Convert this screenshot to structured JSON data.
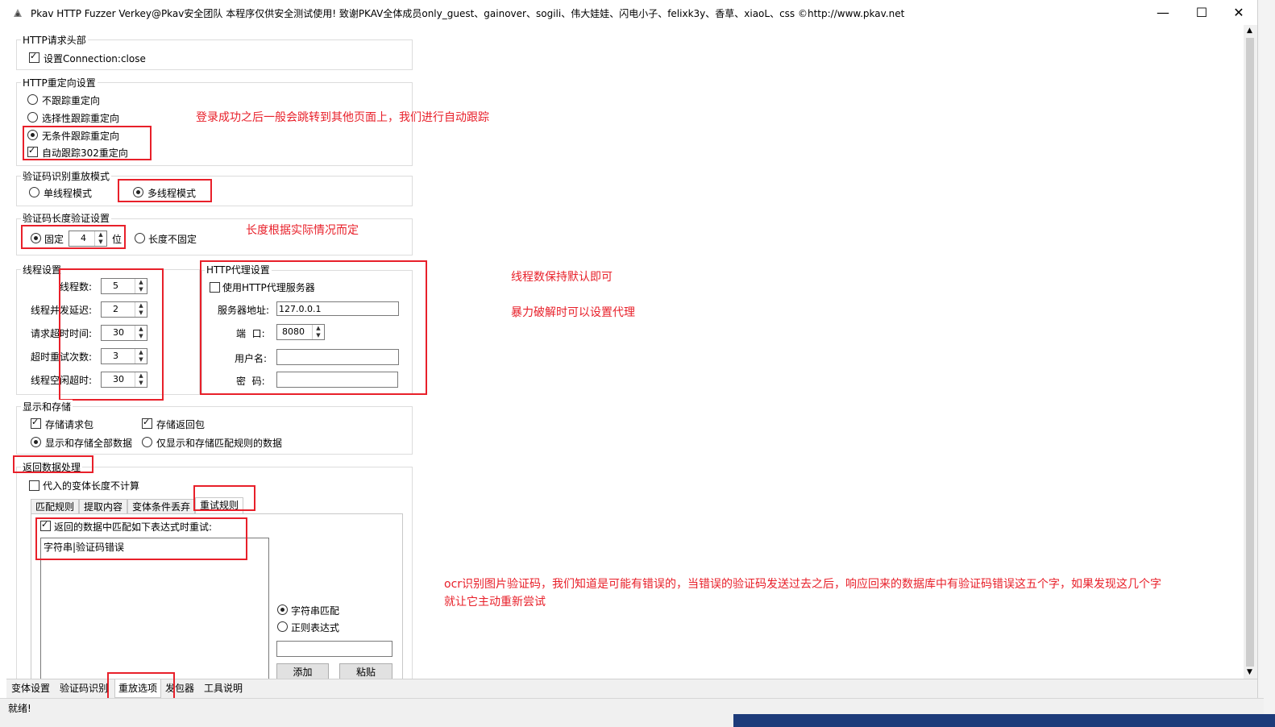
{
  "window": {
    "title": "Pkav HTTP Fuzzer   Verkey@Pkav安全团队  本程序仅供安全测试使用!  致谢PKAV全体成员only_guest、gainover、sogili、伟大娃娃、闪电小子、felixk3y、香草、xiaoL、css  ©http://www.pkav.net",
    "minimize": "—",
    "maximize": "☐",
    "close": "✕"
  },
  "http_headers": {
    "title": "HTTP请求头部",
    "set_connection_close": {
      "label": "设置Connection:close",
      "checked": true
    }
  },
  "redirect": {
    "title": "HTTP重定向设置",
    "no_follow": {
      "label": "不跟踪重定向",
      "checked": false
    },
    "selective_follow": {
      "label": "选择性跟踪重定向",
      "checked": false
    },
    "unconditional_follow": {
      "label": "无条件跟踪重定向",
      "checked": true
    },
    "auto_follow_302": {
      "label": "自动跟踪302重定向",
      "checked": true
    }
  },
  "captcha_replay": {
    "title": "验证码识别重放模式",
    "single_thread": {
      "label": "单线程模式",
      "checked": false
    },
    "multi_thread": {
      "label": "多线程模式",
      "checked": true
    }
  },
  "captcha_length": {
    "title": "验证码长度验证设置",
    "fixed": {
      "label": "固定",
      "checked": true
    },
    "fixed_value": "4",
    "unit": "位",
    "not_fixed": {
      "label": "长度不固定",
      "checked": false
    }
  },
  "threads": {
    "title": "线程设置",
    "thread_count": {
      "label": "线程数:",
      "value": "5"
    },
    "concurrency_delay": {
      "label": "线程并发延迟:",
      "value": "2"
    },
    "request_timeout": {
      "label": "请求超时时间:",
      "value": "30"
    },
    "timeout_retries": {
      "label": "超时重试次数:",
      "value": "3"
    },
    "idle_timeout": {
      "label": "线程空闲超时:",
      "value": "30"
    }
  },
  "proxy": {
    "title": "HTTP代理设置",
    "use_proxy": {
      "label": "使用HTTP代理服务器",
      "checked": false
    },
    "server_label": "服务器地址:",
    "server_value": "127.0.0.1",
    "port_label": "端  口:",
    "port_value": "8080",
    "username_label": "用户名:",
    "username_value": "",
    "password_label": "密  码:",
    "password_value": ""
  },
  "display_storage": {
    "title": "显示和存储",
    "store_request": {
      "label": "存储请求包",
      "checked": true
    },
    "store_response": {
      "label": "存储返回包",
      "checked": true
    },
    "show_all": {
      "label": "显示和存储全部数据",
      "checked": true
    },
    "show_matched": {
      "label": "仅显示和存储匹配规则的数据",
      "checked": false
    }
  },
  "response_processing": {
    "title": "返回数据处理",
    "ignore_var_length": {
      "label": "代入的变体长度不计算",
      "checked": false
    },
    "tabs": [
      "匹配规则",
      "提取内容",
      "变体条件丢弃",
      "重试规则"
    ],
    "retry_on_match": {
      "label": "返回的数据中匹配如下表达式时重试:",
      "checked": true
    },
    "expression_text": "字符串|验证码错误",
    "string_match": {
      "label": "字符串匹配",
      "checked": true
    },
    "regex_match": {
      "label": "正则表达式",
      "checked": false
    },
    "add_button": "添加",
    "paste_button": "粘贴"
  },
  "bottom_tabs": [
    "变体设置",
    "验证码识别",
    "重放选项",
    "发包器",
    "工具说明"
  ],
  "status": "就绪!",
  "annotations": {
    "redirect_note": "登录成功之后一般会跳转到其他页面上，我们进行自动跟踪",
    "length_note": "长度根据实际情况而定",
    "threads_note": "线程数保持默认即可",
    "proxy_note": "暴力破解时可以设置代理",
    "ocr_note_1": "ocr识别图片验证码，我们知道是可能有错误的，当错误的验证码发送过去之后，响应回来的数据库中有验证码错误这五个字，如果发现这几个字",
    "ocr_note_2": "就让它主动重新尝试"
  },
  "colors": {
    "annotation": "#e8202a",
    "taskbar": "#1d3b7a"
  }
}
